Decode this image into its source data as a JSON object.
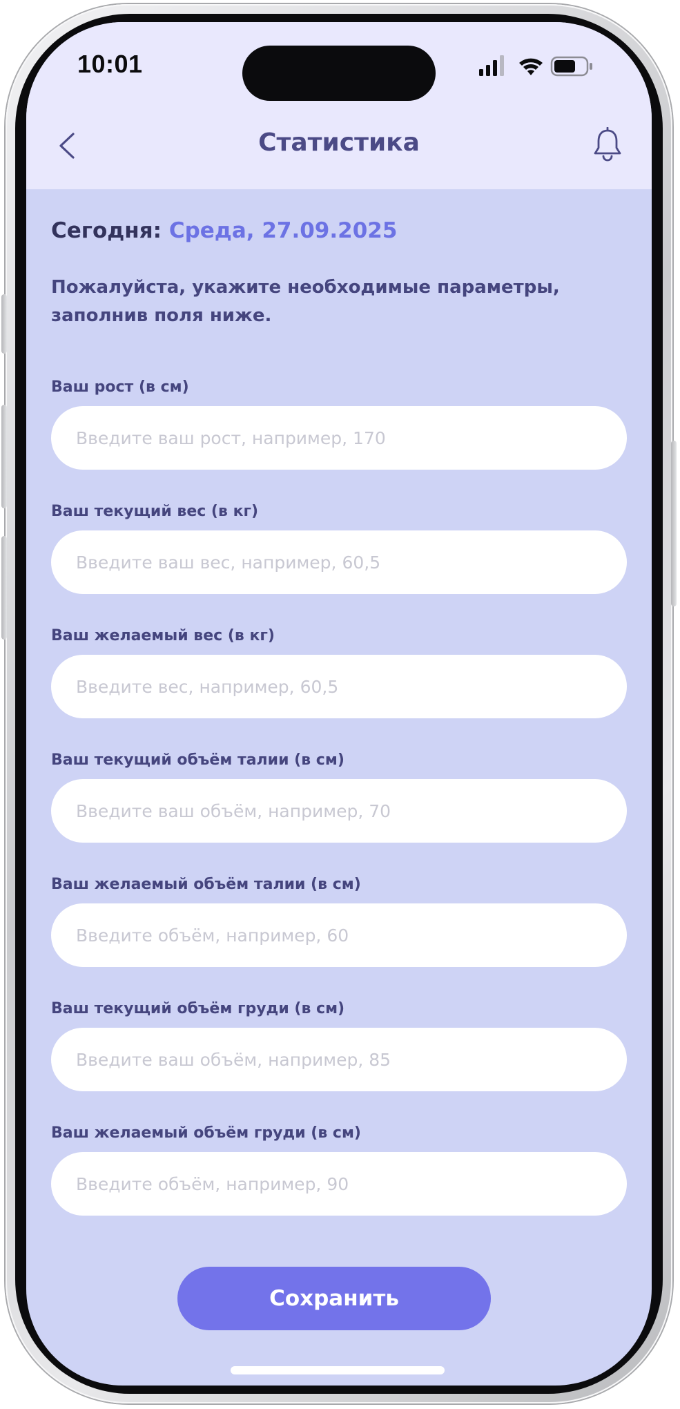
{
  "status_bar": {
    "time": "10:01"
  },
  "header": {
    "title": "Статистика",
    "back_icon": "chevron-left-icon",
    "bell_icon": "bell-icon"
  },
  "today": {
    "label": "Сегодня:",
    "value": "Среда, 27.09.2025"
  },
  "instruction": "Пожалуйста, укажите необходимые параметры, заполнив поля ниже.",
  "fields": [
    {
      "label": "Ваш рост (в см)",
      "value": "",
      "placeholder": "Введите ваш рост, например, 170"
    },
    {
      "label": "Ваш текущий вес (в кг)",
      "value": "",
      "placeholder": "Введите ваш вес, например, 60,5"
    },
    {
      "label": "Ваш желаемый вес (в кг)",
      "value": "",
      "placeholder": "Введите вес, например, 60,5"
    },
    {
      "label": "Ваш текущий объём талии (в см)",
      "value": "",
      "placeholder": "Введите ваш объём, например, 70"
    },
    {
      "label": "Ваш желаемый объём талии (в см)",
      "value": "",
      "placeholder": "Введите объём, например, 60"
    },
    {
      "label": "Ваш текущий объём груди (в см)",
      "value": "",
      "placeholder": "Введите ваш объём, например, 85"
    },
    {
      "label": "Ваш желаемый объём груди (в см)",
      "value": "",
      "placeholder": "Введите объём, например, 90"
    }
  ],
  "save_button": {
    "label": "Сохранить"
  },
  "colors": {
    "header_bg": "#e9e8fd",
    "body_bg": "#ced3f5",
    "accent": "#7373ea",
    "date_accent": "#6c72e4",
    "text_primary": "#45457e"
  }
}
